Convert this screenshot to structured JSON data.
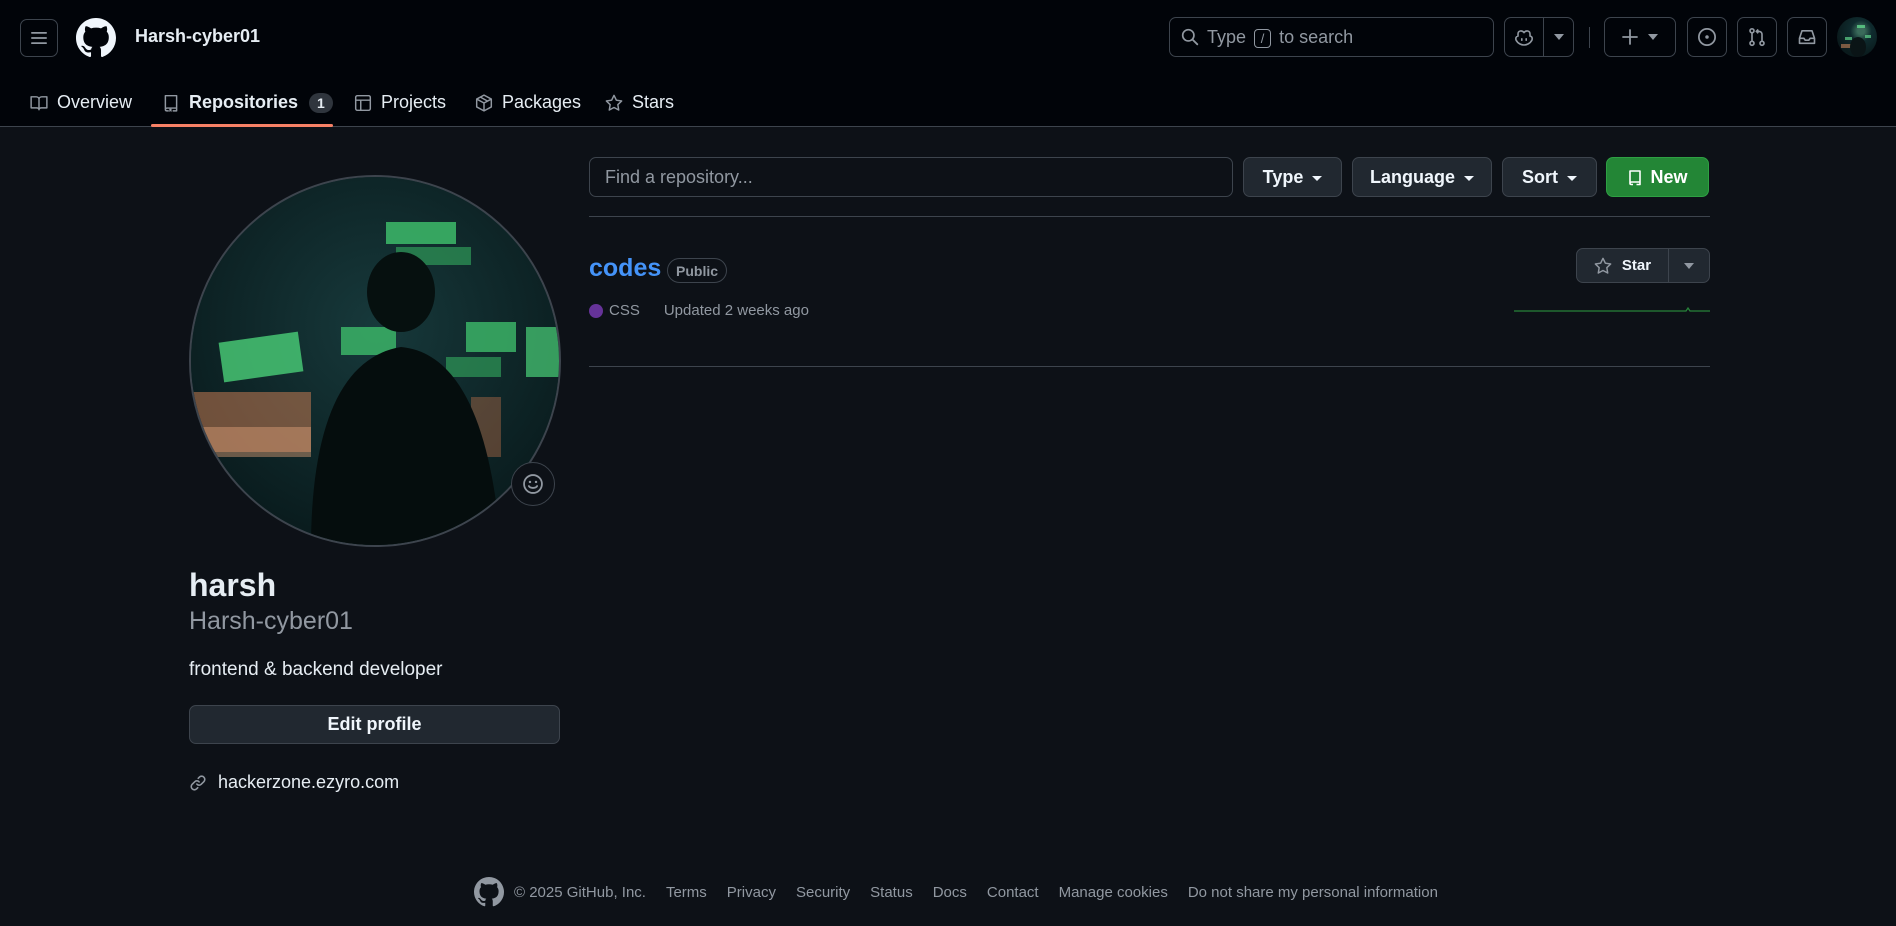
{
  "header": {
    "context_title": "Harsh-cyber01",
    "search": {
      "before": "Type",
      "key": "/",
      "after": "to search"
    }
  },
  "tabs": [
    {
      "label": "Overview",
      "icon": "book-icon"
    },
    {
      "label": "Repositories",
      "icon": "repo-icon",
      "count": "1",
      "active": true
    },
    {
      "label": "Projects",
      "icon": "table-icon"
    },
    {
      "label": "Packages",
      "icon": "package-icon"
    },
    {
      "label": "Stars",
      "icon": "star-icon"
    }
  ],
  "profile": {
    "name": "harsh",
    "login": "Harsh-cyber01",
    "bio": "frontend & backend developer",
    "edit_label": "Edit profile",
    "website": "hackerzone.ezyro.com"
  },
  "repo_filters": {
    "search_placeholder": "Find a repository...",
    "type_label": "Type",
    "language_label": "Language",
    "sort_label": "Sort",
    "new_label": "New"
  },
  "repositories": [
    {
      "name": "codes",
      "visibility": "Public",
      "language": "CSS",
      "language_color": "#663399",
      "updated": "Updated 2 weeks ago",
      "star_label": "Star"
    }
  ],
  "footer": {
    "copyright": "© 2025 GitHub, Inc.",
    "links": [
      "Terms",
      "Privacy",
      "Security",
      "Status",
      "Docs",
      "Contact",
      "Manage cookies",
      "Do not share my personal information"
    ]
  },
  "colors": {
    "background": "#0d1117",
    "header_bg": "#010409",
    "accent_link": "#4493f8",
    "primary_button": "#238636",
    "active_tab_underline": "#f78166"
  }
}
